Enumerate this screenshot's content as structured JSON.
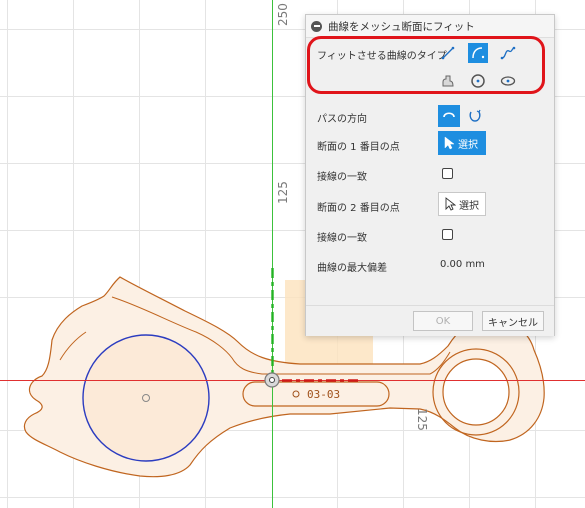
{
  "canvas": {
    "ruler_labels": {
      "top": "250",
      "mid": "125",
      "right": "125"
    },
    "part_label": "03-03",
    "colors": {
      "grid": "#e1e1e1",
      "part_outline": "#c0651f",
      "part_fill": "#fbeee2",
      "fit_circle": "#2b3cc0",
      "axis_red": "#e03030",
      "axis_green": "#3cc13c",
      "highlight": "#e0141a"
    }
  },
  "dialog": {
    "title": "曲線をメッシュ断面にフィット",
    "curve_type": {
      "label": "フィットさせる曲線のタイプ",
      "icons": [
        "line-icon",
        "arc-icon",
        "spline-icon",
        "conic-icon",
        "circle-icon",
        "ellipse-icon"
      ],
      "selected": "arc-icon"
    },
    "path_direction": {
      "label": "パスの方向",
      "icons": [
        "arc-direction-icon",
        "reverse-direction-icon"
      ],
      "selected": "arc-direction-icon"
    },
    "first_point": {
      "label": "断面の 1 番目の点",
      "button": "選択",
      "active": true
    },
    "tangent_1": {
      "label": "接線の一致",
      "checked": false
    },
    "second_point": {
      "label": "断面の 2 番目の点",
      "button": "選択",
      "active": false
    },
    "tangent_2": {
      "label": "接線の一致",
      "checked": false
    },
    "max_deviation": {
      "label": "曲線の最大偏差",
      "value": "0.00 mm"
    },
    "buttons": {
      "ok": "OK",
      "cancel": "キャンセル"
    },
    "accent": "#1e8ee0"
  }
}
